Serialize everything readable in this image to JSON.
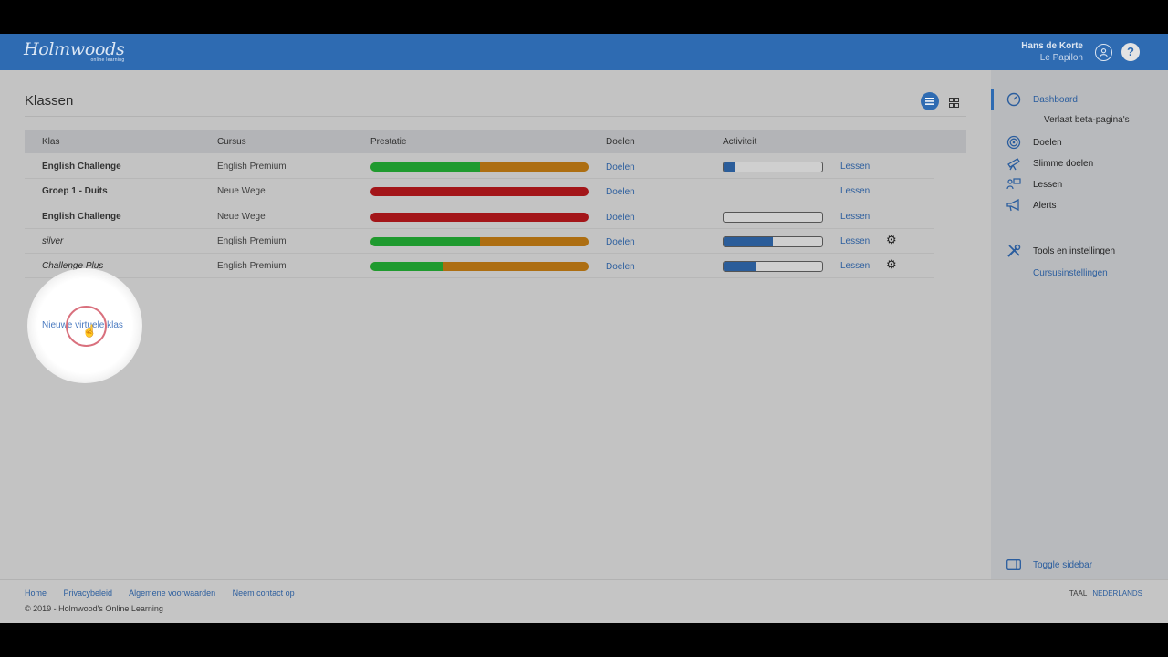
{
  "header": {
    "logo_main": "Holmwoods",
    "logo_sub": "online learning",
    "user_name": "Hans de Korte",
    "user_org": "Le Papilon",
    "help_label": "?"
  },
  "main": {
    "title": "Klassen",
    "columns": [
      "Klas",
      "Cursus",
      "Prestatie",
      "Doelen",
      "Activiteit"
    ],
    "rows": [
      {
        "klas": "English Challenge",
        "cursus": "English Premium",
        "perf_green": 0.5,
        "perf_red": false,
        "doelen": "Doelen",
        "activity": 0.12,
        "show_activity": true,
        "lessen": "Lessen",
        "virtual": false
      },
      {
        "klas": "Groep 1 - Duits",
        "cursus": "Neue Wege",
        "perf_green": 0,
        "perf_red": true,
        "doelen": "Doelen",
        "activity": 0,
        "show_activity": false,
        "lessen": "Lessen",
        "virtual": false
      },
      {
        "klas": "English Challenge",
        "cursus": "Neue Wege",
        "perf_green": 0,
        "perf_red": true,
        "doelen": "Doelen",
        "activity": 0,
        "show_activity": true,
        "lessen": "Lessen",
        "virtual": false
      },
      {
        "klas": "silver",
        "cursus": "English Premium",
        "perf_green": 0.5,
        "perf_red": false,
        "doelen": "Doelen",
        "activity": 0.5,
        "show_activity": true,
        "lessen": "Lessen",
        "virtual": true
      },
      {
        "klas": "Challenge Plus",
        "cursus": "English Premium",
        "perf_green": 0.33,
        "perf_red": false,
        "doelen": "Doelen",
        "activity": 0.33,
        "show_activity": true,
        "lessen": "Lessen",
        "virtual": true
      }
    ],
    "new_virtual_class": "Nieuwe virtuele klas"
  },
  "sidebar": {
    "dashboard": "Dashboard",
    "leave_beta": "Verlaat beta-pagina's",
    "doelen": "Doelen",
    "slimme_doelen": "Slimme doelen",
    "lessen": "Lessen",
    "alerts": "Alerts",
    "tools": "Tools en instellingen",
    "cursusinstellingen": "Cursusinstellingen",
    "toggle": "Toggle sidebar"
  },
  "footer": {
    "links": [
      "Home",
      "Privacybeleid",
      "Algemene voorwaarden",
      "Neem contact op"
    ],
    "copyright": "© 2019 - Holmwood's Online Learning",
    "lang_label": "TAAL",
    "lang_value": "NEDERLANDS"
  },
  "colors": {
    "accent": "#2e6bb2",
    "success": "#1f9a2f",
    "warning": "#ad6e12",
    "danger": "#a31519"
  }
}
